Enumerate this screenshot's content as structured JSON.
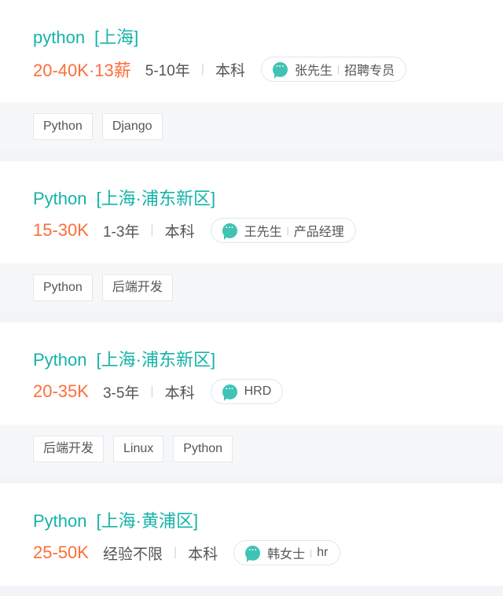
{
  "jobs": [
    {
      "title": "python",
      "location": "[上海]",
      "salary": "20-40K·13薪",
      "experience": "5-10年",
      "education": "本科",
      "recruiter": {
        "name": "张先生",
        "title": "招聘专员"
      },
      "tags": [
        "Python",
        "Django"
      ]
    },
    {
      "title": "Python",
      "location": "[上海·浦东新区]",
      "salary": "15-30K",
      "experience": "1-3年",
      "education": "本科",
      "recruiter": {
        "name": "王先生",
        "title": "产品经理"
      },
      "tags": [
        "Python",
        "后端开发"
      ]
    },
    {
      "title": "Python",
      "location": "[上海·浦东新区]",
      "salary": "20-35K",
      "experience": "3-5年",
      "education": "本科",
      "recruiter": {
        "name": "HRD",
        "title": ""
      },
      "tags": [
        "后端开发",
        "Linux",
        "Python"
      ]
    },
    {
      "title": "Python",
      "location": "[上海·黄浦区]",
      "salary": "25-50K",
      "experience": "经验不限",
      "education": "本科",
      "recruiter": {
        "name": "韩女士",
        "title": "hr"
      },
      "tags": []
    }
  ],
  "icons": {
    "chat": "chat-bubble-icon"
  },
  "colors": {
    "title": "#14b3a8",
    "salary": "#fd6e3c",
    "chat": "#3fc3b5",
    "text": "#555555"
  }
}
